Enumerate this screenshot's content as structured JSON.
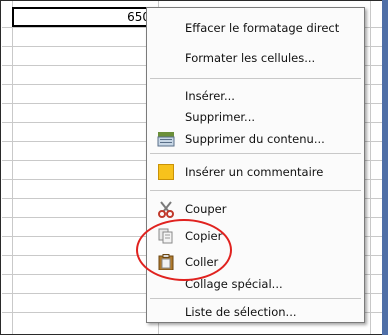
{
  "cell": {
    "value": "650"
  },
  "context_menu": {
    "items": [
      {
        "label": "Effacer le formatage direct",
        "icon": null
      },
      {
        "label": "Formater les cellules...",
        "icon": null
      },
      {
        "label": "Insérer...",
        "icon": null
      },
      {
        "label": "Supprimer...",
        "icon": null
      },
      {
        "label": "Supprimer du contenu...",
        "icon": "delete-contents-icon"
      },
      {
        "label": "Insérer un commentaire",
        "icon": "comment-icon"
      },
      {
        "label": "Couper",
        "icon": "scissors-icon"
      },
      {
        "label": "Copier",
        "icon": "copy-icon"
      },
      {
        "label": "Coller",
        "icon": "paste-icon"
      },
      {
        "label": "Collage spécial...",
        "icon": null
      },
      {
        "label": "Liste de sélection...",
        "icon": null
      }
    ]
  },
  "annotation": {
    "color": "#e0221f"
  }
}
